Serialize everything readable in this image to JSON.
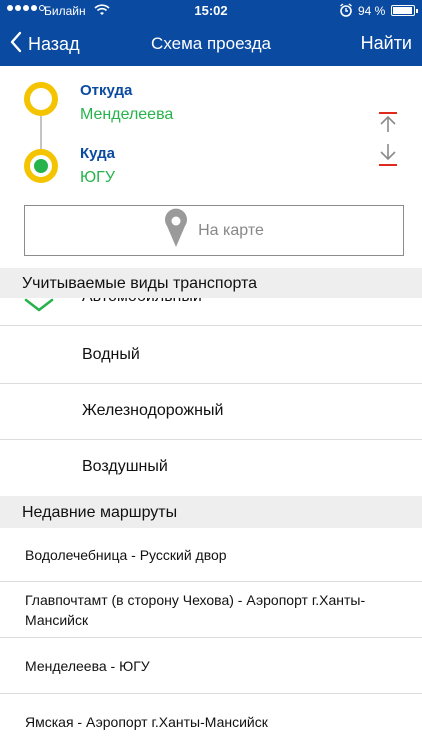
{
  "status_bar": {
    "carrier": "Билайн",
    "time": "15:02",
    "battery_percent": "94 %",
    "battery_level": 0.94
  },
  "nav": {
    "back_label": "Назад",
    "title": "Схема проезда",
    "action_label": "Найти"
  },
  "route": {
    "from_label": "Откуда",
    "from_value": "Менделеева",
    "to_label": "Куда",
    "to_value": "ЮГУ",
    "map_button_label": "На карте"
  },
  "transport": {
    "header": "Учитываемые виды транспорта",
    "items": [
      {
        "label": "Автомобильный",
        "checked": true
      },
      {
        "label": "Водный",
        "checked": false
      },
      {
        "label": "Железнодорожный",
        "checked": false
      },
      {
        "label": "Воздушный",
        "checked": false
      }
    ]
  },
  "recent": {
    "header": "Недавние маршруты",
    "items": [
      {
        "label": "Водолечебница - Русский двор"
      },
      {
        "label": "Главпочтамт (в сторону Чехова) - Аэропорт г.Ханты-Мансийск"
      },
      {
        "label": "Менделеева - ЮГУ"
      },
      {
        "label": "Ямская - Аэропорт г.Ханты-Мансийск"
      }
    ]
  },
  "colors": {
    "header_bg": "#0a4aa0",
    "accent_yellow": "#f4c400",
    "accent_green": "#27b34b",
    "swap_red": "#e0291f"
  }
}
